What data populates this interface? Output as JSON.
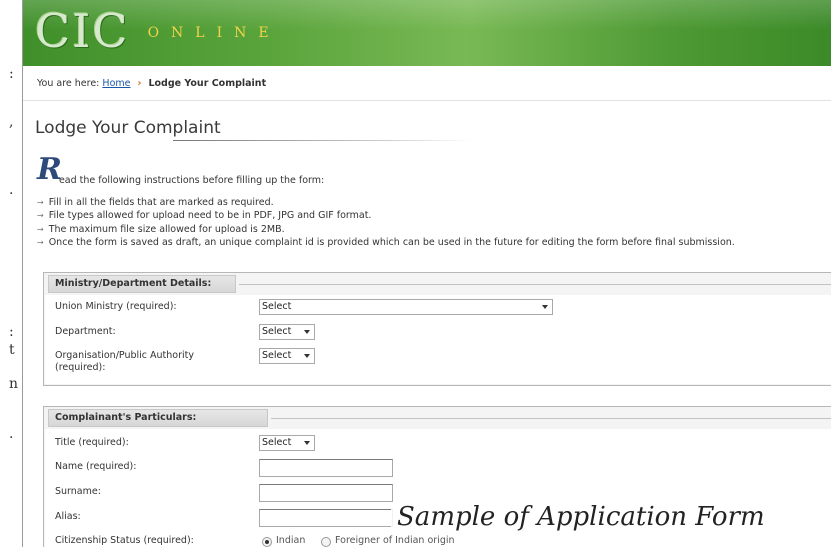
{
  "left_edge_chars": [
    ":",
    ",",
    ".",
    ":",
    "t",
    "n",
    "."
  ],
  "header": {
    "logo_main": "CIC",
    "logo_sub": "ONLINE"
  },
  "breadcrumb": {
    "prefix": "You are here:",
    "home": "Home",
    "separator": "›",
    "current": "Lodge Your Complaint"
  },
  "page_title": "Lodge Your Complaint",
  "intro": {
    "drop_cap": "R",
    "rest": "ead the following instructions before filling up the form:"
  },
  "instructions": [
    "Fill in all the fields that are marked as required.",
    "File types allowed for upload need to be in PDF, JPG and GIF format.",
    "The maximum file size allowed for upload is 2MB.",
    "Once the form is saved as draft, an unique complaint id is provided which can be used in the future for editing the form before final submission."
  ],
  "instruction_bullet": "→",
  "ministry_section": {
    "title": "Ministry/Department Details:",
    "union_ministry_label": "Union Ministry (required):",
    "union_ministry_value": "Select",
    "department_label": "Department:",
    "department_value": "Select",
    "organisation_label_line1": "Organisation/Public Authority",
    "organisation_label_line2": "(required):",
    "organisation_value": "Select"
  },
  "complainant_section": {
    "title": "Complainant's Particulars:",
    "title_label": "Title (required):",
    "title_value": "Select",
    "name_label": "Name (required):",
    "name_value": "",
    "surname_label": "Surname:",
    "surname_value": "",
    "alias_label": "Alias:",
    "alias_value": "",
    "citizenship_label": "Citizenship Status (required):",
    "citizenship_option1": "Indian",
    "citizenship_option2": "Foreigner of Indian origin"
  },
  "caption": "Sample of Application Form"
}
